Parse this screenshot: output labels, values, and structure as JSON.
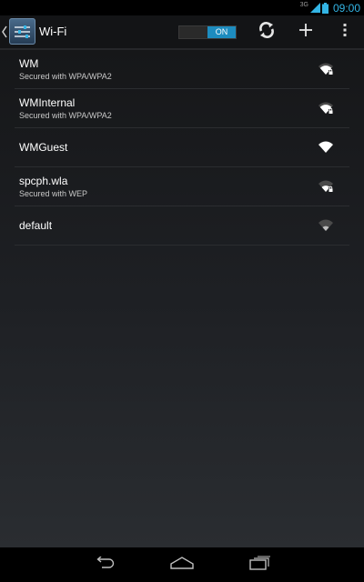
{
  "status_bar": {
    "network_type": "3G",
    "clock": "09:00"
  },
  "action_bar": {
    "title": "Wi-Fi",
    "toggle_label": "ON",
    "icons": [
      "settings-app-icon",
      "scan-icon",
      "add-network-icon",
      "overflow-menu-icon"
    ]
  },
  "networks": [
    {
      "name": "WM",
      "security": "Secured with WPA/WPA2",
      "locked": true,
      "signal": 0.85
    },
    {
      "name": "WMInternal",
      "security": "Secured with WPA/WPA2",
      "locked": true,
      "signal": 0.85
    },
    {
      "name": "WMGuest",
      "security": "",
      "locked": false,
      "signal": 0.95
    },
    {
      "name": "spcph.wla",
      "security": "Secured with WEP",
      "locked": true,
      "signal": 0.5
    },
    {
      "name": "default",
      "security": "",
      "locked": false,
      "signal": 0.4
    }
  ],
  "nav_bar": {
    "icons": [
      "back-icon",
      "home-icon",
      "recent-apps-icon"
    ]
  },
  "colors": {
    "accent": "#33b5e5",
    "toggle_on": "#1d8cbf",
    "action_bar_bg": "#131416"
  }
}
